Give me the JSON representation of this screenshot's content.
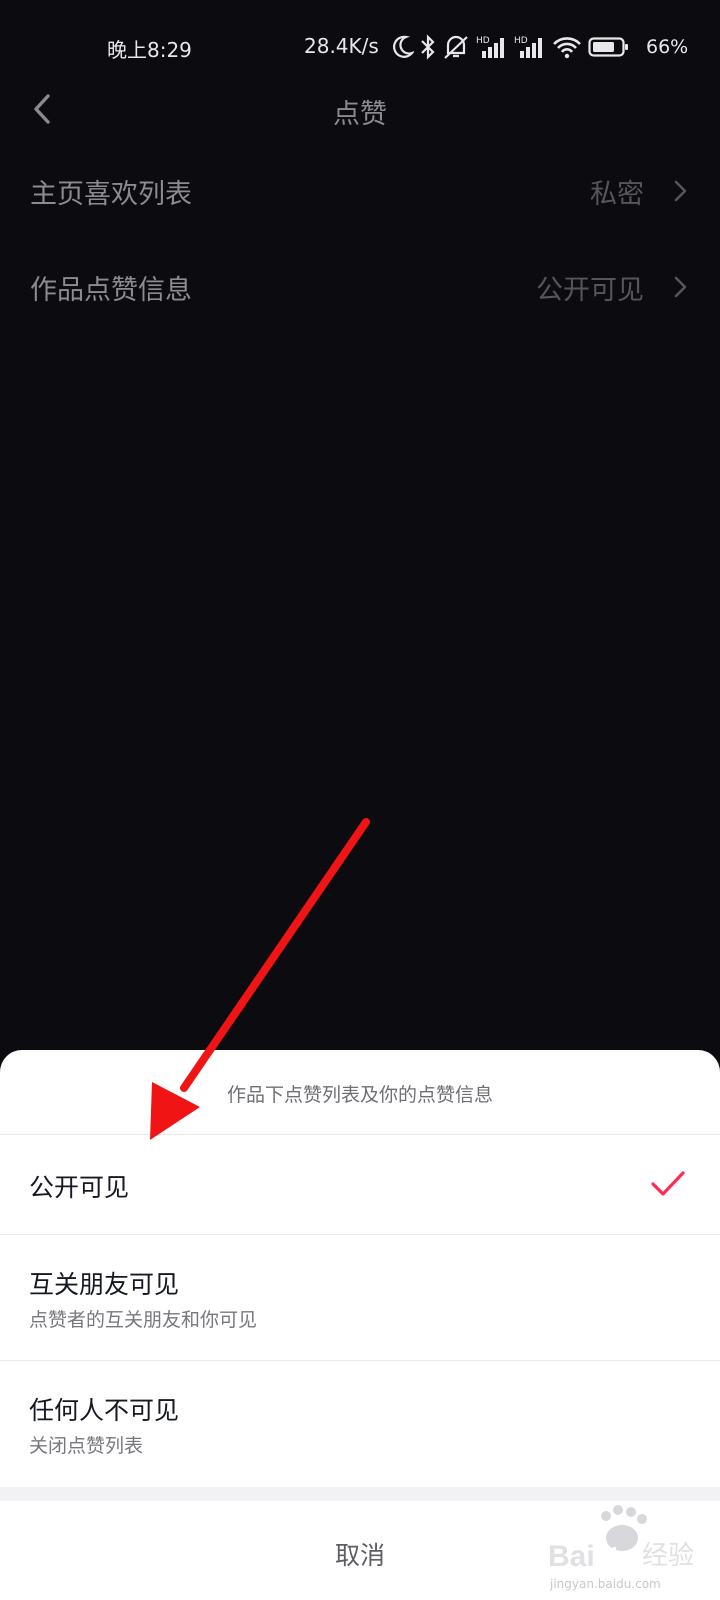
{
  "status_bar": {
    "time": "晚上8:29",
    "net_speed": "28.4K/s",
    "battery_pct": "66%",
    "icons": [
      "moon-icon",
      "bluetooth-icon",
      "mute-icon",
      "hd-signal-icon",
      "hd-signal-icon",
      "wifi-icon",
      "battery-icon"
    ]
  },
  "nav": {
    "title": "点赞",
    "back_icon": "chevron-left-icon"
  },
  "settings": [
    {
      "label": "主页喜欢列表",
      "value": "私密"
    },
    {
      "label": "作品点赞信息",
      "value": "公开可见"
    }
  ],
  "sheet": {
    "title": "作品下点赞列表及你的点赞信息",
    "options": [
      {
        "label": "公开可见",
        "sub": "",
        "selected": true
      },
      {
        "label": "互关朋友可见",
        "sub": "点赞者的互关朋友和你可见",
        "selected": false
      },
      {
        "label": "任何人不可见",
        "sub": "关闭点赞列表",
        "selected": false
      }
    ],
    "cancel": "取消"
  },
  "watermark": {
    "brand": "Bai du 经验",
    "url": "jingyan.baidu.com"
  },
  "colors": {
    "accent_check": "#fe2c55",
    "annotation_arrow": "#f01414",
    "background": "#0b0b10"
  }
}
